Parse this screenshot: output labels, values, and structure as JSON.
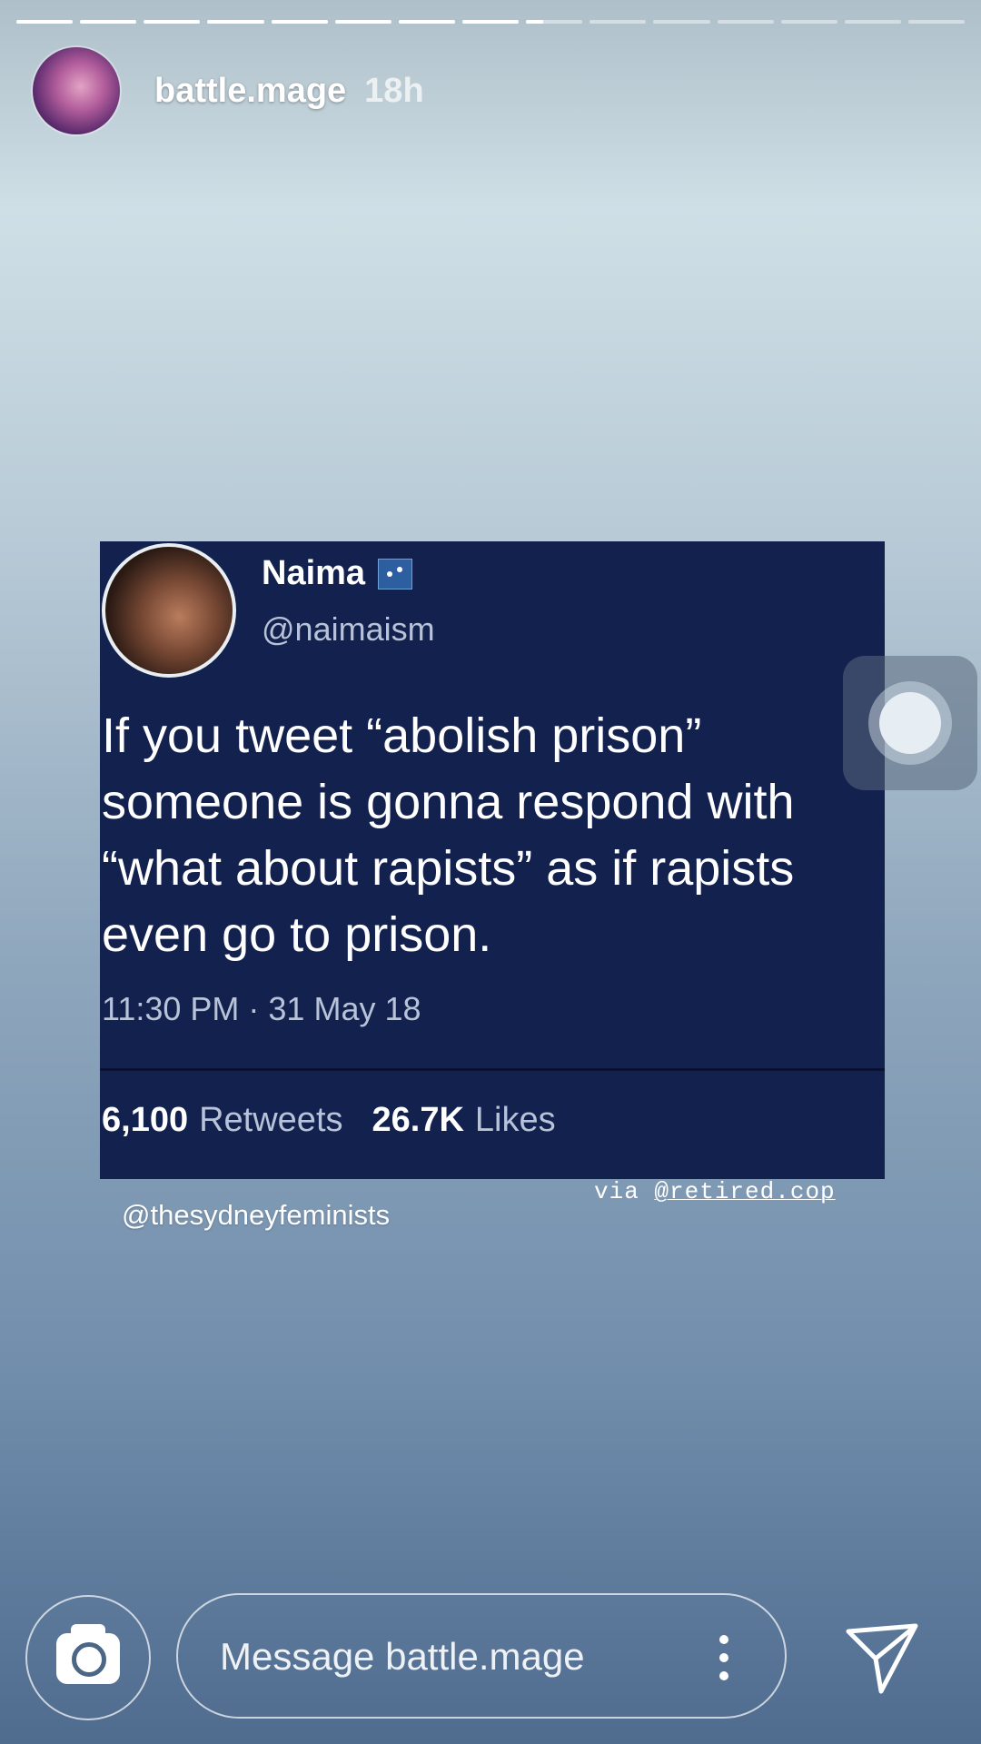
{
  "story": {
    "progress": {
      "segments": 15,
      "current_index": 8,
      "current_fraction": 0.3
    },
    "user": {
      "username": "battle.mage",
      "time_ago": "18h"
    }
  },
  "tweet": {
    "name": "Naima",
    "handle": "@naimaism",
    "text": "If you tweet “abolish prison” someone is gonna respond with “what about rapists” as if rapists even go to prison.",
    "timestamp": "11:30 PM · 31 May 18",
    "retweets_count": "6,100",
    "retweets_label": "Retweets",
    "likes_count": "26.7K",
    "likes_label": "Likes"
  },
  "overlay": {
    "via_prefix": "via",
    "via_handle": "@retired.cop",
    "credit": "@thesydneyfeminists"
  },
  "composer": {
    "placeholder": "Message battle.mage"
  },
  "icons": {
    "camera": "camera-icon",
    "more": "more-vertical-icon",
    "send": "send-icon",
    "assistive": "assistive-touch-icon"
  }
}
